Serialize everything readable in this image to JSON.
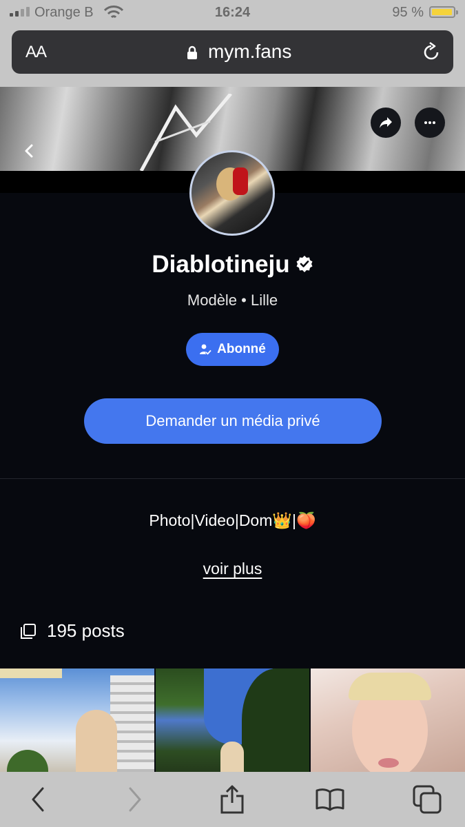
{
  "status_bar": {
    "carrier": "Orange B",
    "time": "16:24",
    "battery": "95 %",
    "battery_level": 0.95
  },
  "browser": {
    "aa_label": "AA",
    "domain": "mym.fans"
  },
  "profile": {
    "name": "Diablotineju",
    "subtitle": "Modèle • Lille",
    "subscribed_label": "Abonné",
    "cta_label": "Demander un média privé",
    "bio": "Photo|Video|Dom👑|🍑",
    "more_label": "voir plus",
    "posts_label": "195 posts"
  },
  "colors": {
    "accent": "#4477ee",
    "background": "#07090f",
    "battery": "#f5d33a"
  },
  "icons": [
    "signal-icon",
    "wifi-icon",
    "battery-icon",
    "lock-icon",
    "reload-icon",
    "back-icon",
    "share-icon",
    "more-icon",
    "verified-icon",
    "user-check-icon",
    "posts-icon",
    "chevron-left-icon",
    "chevron-right-icon",
    "share-upload-icon",
    "bookmarks-icon",
    "tabs-icon"
  ]
}
